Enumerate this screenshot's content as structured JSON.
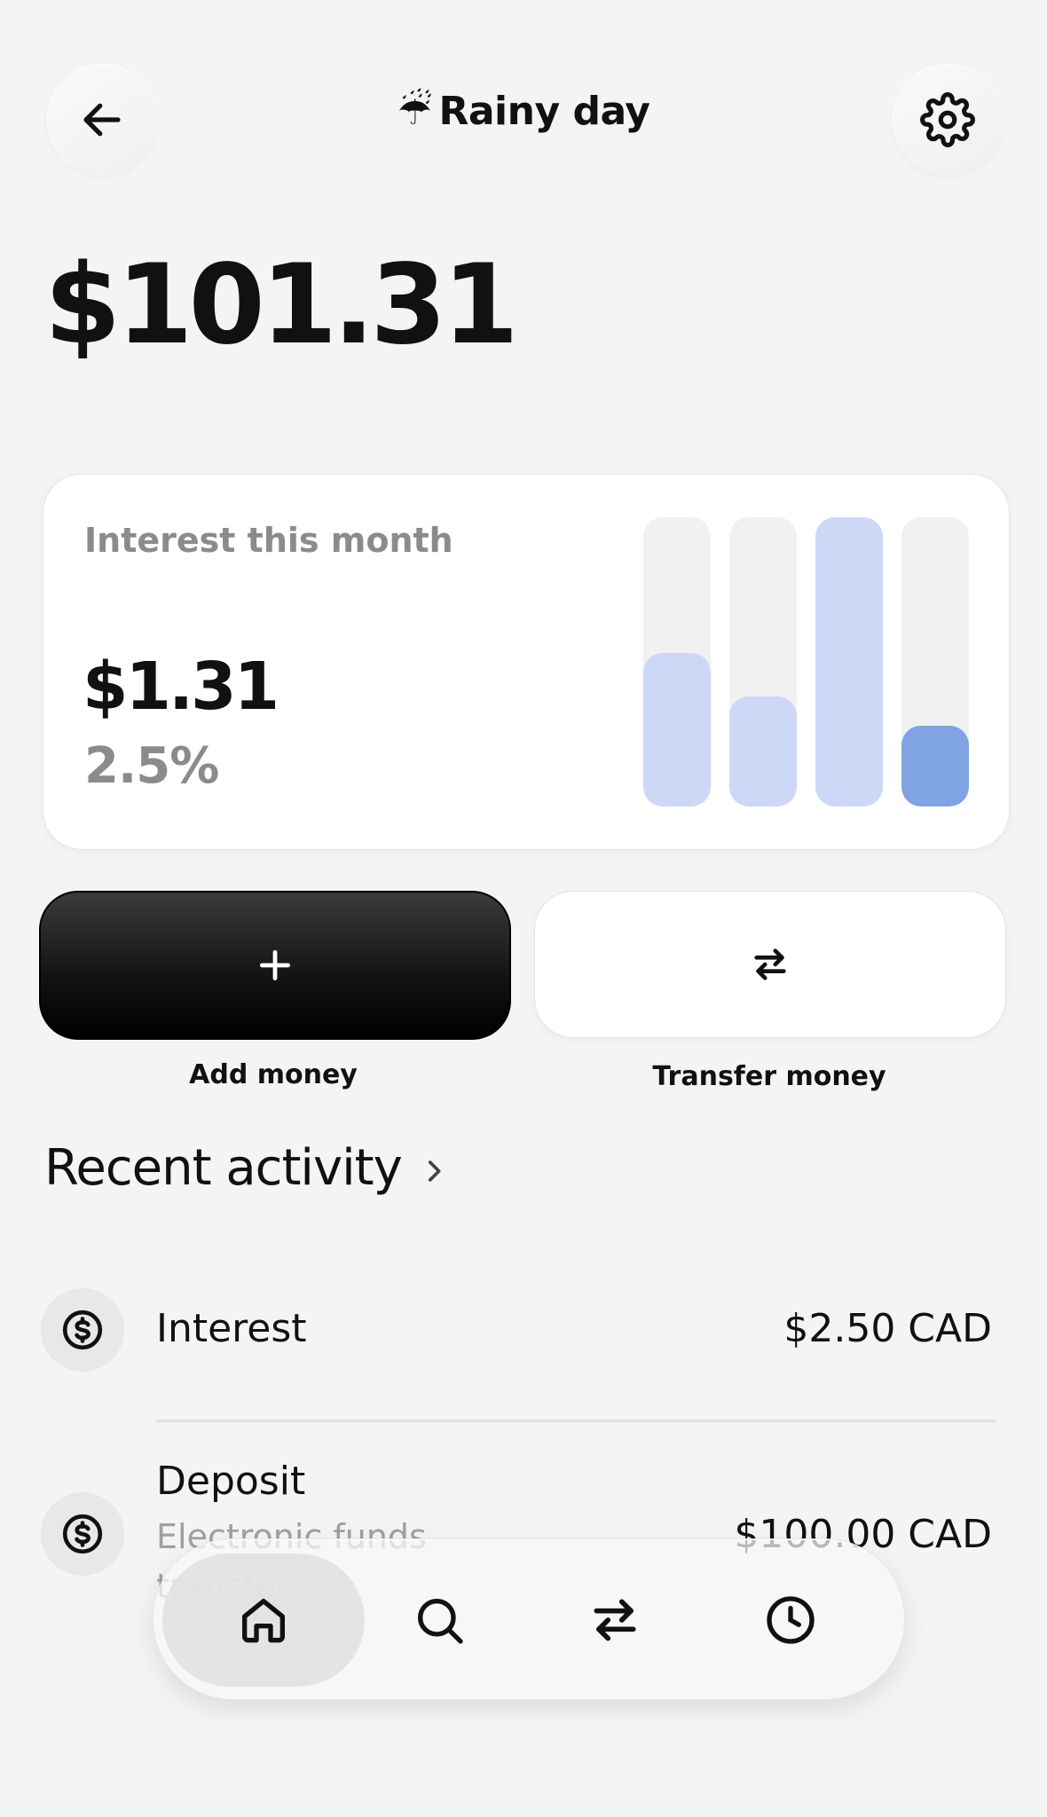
{
  "header": {
    "title_emoji": "☔",
    "title": "Rainy day",
    "back_icon": "arrow-left-icon",
    "settings_icon": "gear-icon"
  },
  "balance": "$101.31",
  "interest_card": {
    "label": "Interest this month",
    "amount": "$1.31",
    "rate": "2.5%",
    "bars": [
      {
        "fill_fraction": 0.53,
        "highlighted": false
      },
      {
        "fill_fraction": 0.38,
        "highlighted": false
      },
      {
        "fill_fraction": 1.0,
        "highlighted": false
      },
      {
        "fill_fraction": 0.28,
        "highlighted": true
      }
    ],
    "colors": {
      "bar": "#ccd8f6",
      "bar_current": "#7fa3e3",
      "track": "#f1f1f1"
    }
  },
  "actions": {
    "add": {
      "label": "Add money",
      "icon": "plus-icon"
    },
    "transfer": {
      "label": "Transfer money",
      "icon": "swap-arrows-icon"
    }
  },
  "recent": {
    "title": "Recent activity",
    "chevron_icon": "chevron-right-icon",
    "items": [
      {
        "title": "Interest",
        "subtitle": "",
        "amount": "$2.50 CAD",
        "icon": "dollar-circle-icon"
      },
      {
        "title": "Deposit",
        "subtitle": "Electronic funds transfer",
        "amount": "$100.00 CAD",
        "icon": "dollar-circle-icon"
      }
    ]
  },
  "nav": {
    "items": [
      {
        "name": "home",
        "icon": "home-icon",
        "active": true
      },
      {
        "name": "search",
        "icon": "search-icon",
        "active": false
      },
      {
        "name": "transfer",
        "icon": "swap-arrows-icon",
        "active": false
      },
      {
        "name": "history",
        "icon": "clock-icon",
        "active": false
      }
    ]
  }
}
